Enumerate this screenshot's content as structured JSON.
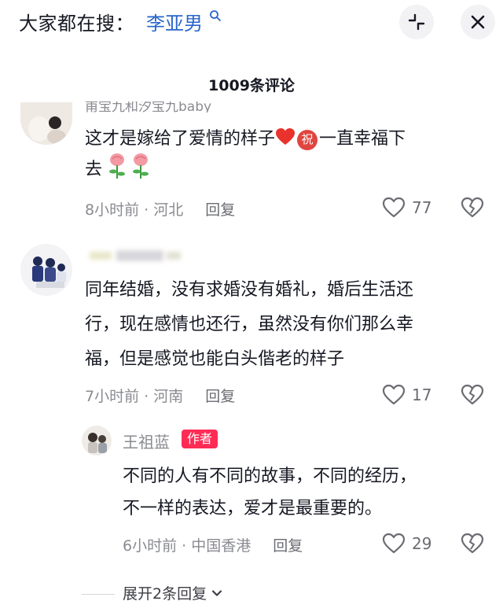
{
  "search": {
    "prefix": "大家都在搜：",
    "keyword": "李亚男"
  },
  "header": {
    "comments_count": "1009条评论"
  },
  "comments": [
    {
      "username": "甫宝九和汐宝九baby",
      "text_line1": "这才是嫁给了爱情的样子",
      "text_line1_tail": "一直幸福下",
      "text_line2": "去",
      "emoji_zhu": "祝",
      "time_location": "8小时前 · 河北",
      "reply_label": "回复",
      "likes": "77"
    },
    {
      "username": "",
      "text_lines": [
        "同年结婚，没有求婚没有婚礼，婚后生活还",
        "行，现在感情也还行，虽然没有你们那么幸",
        "福，但是感觉也能白头偕老的样子"
      ],
      "time_location": "7小时前 · 河南",
      "reply_label": "回复",
      "likes": "17"
    }
  ],
  "author_reply": {
    "username": "王祖蓝",
    "badge": "作者",
    "text_lines": [
      "不同的人有不同的故事，不同的经历，",
      "不一样的表达，爱才是最重要的。"
    ],
    "time_location": "6小时前 · 中国香港",
    "reply_label": "回复",
    "likes": "29"
  },
  "expand": {
    "label": "展开2条回复"
  },
  "colors": {
    "keyword": "#2a66c9",
    "badge": "#fe2c55",
    "muted": "#8a8b91"
  },
  "icons": [
    "search-icon",
    "collapse-icon",
    "close-icon",
    "heart-icon",
    "broken-heart-icon",
    "chevron-down-icon"
  ]
}
